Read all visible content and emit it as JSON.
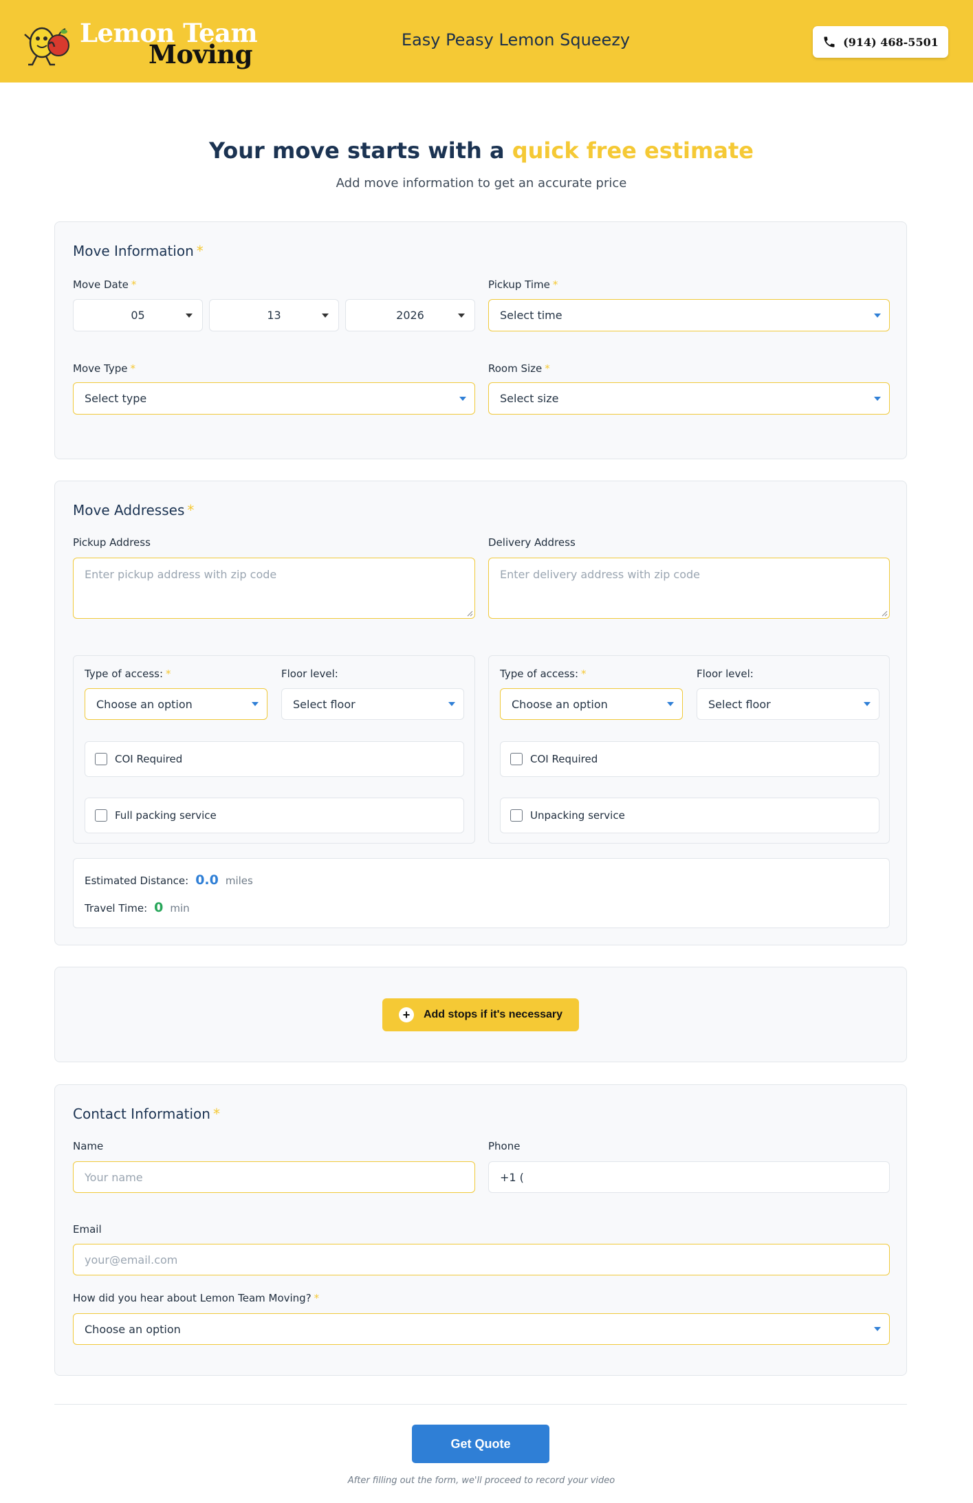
{
  "header": {
    "logo_line1": "Lemon Team",
    "logo_line2": "Moving",
    "tagline": "Easy Peasy Lemon Squeezy",
    "phone": "(914) 468-5501",
    "phone_icon": "phone-icon"
  },
  "hero": {
    "title_main": "Your move starts with a ",
    "title_accent": "quick free estimate",
    "subtitle": "Add move information to get an accurate price"
  },
  "move_info": {
    "title": "Move Information",
    "required_mark": "*",
    "move_date_label": "Move Date",
    "month": "05",
    "day": "13",
    "year": "2026",
    "pickup_time_label": "Pickup Time",
    "pickup_time_value": "Select time",
    "move_type_label": "Move Type",
    "move_type_value": "Select type",
    "room_size_label": "Room Size",
    "room_size_value": "Select size"
  },
  "addresses": {
    "title": "Move Addresses",
    "pickup_label": "Pickup Address",
    "pickup_placeholder": "Enter pickup address with zip code",
    "delivery_label": "Delivery Address",
    "delivery_placeholder": "Enter delivery address with zip code",
    "pickup_panel": {
      "access_label": "Type of access:",
      "access_value": "Choose an option",
      "floor_label": "Floor level:",
      "floor_value": "Select floor",
      "coi_label": "COI Required",
      "service_label": "Full packing service"
    },
    "delivery_panel": {
      "access_label": "Type of access:",
      "access_value": "Choose an option",
      "floor_label": "Floor level:",
      "floor_value": "Select floor",
      "coi_label": "COI Required",
      "service_label": "Unpacking service"
    },
    "distance_label": "Estimated Distance:",
    "distance_value": "0.0",
    "distance_unit": "miles",
    "travel_label": "Travel Time:",
    "travel_value": "0",
    "travel_unit": "min"
  },
  "stops": {
    "button_label": "Add stops if it's necessary",
    "icon": "plus-circle-icon"
  },
  "contact": {
    "title": "Contact Information",
    "name_label": "Name",
    "name_placeholder": "Your name",
    "phone_label": "Phone",
    "phone_value": "+1 (",
    "email_label": "Email",
    "email_placeholder": "your@email.com",
    "referral_label": "How did you hear about Lemon Team Moving?",
    "referral_value": "Choose an option"
  },
  "submit": {
    "button_label": "Get Quote",
    "footnote": "After filling out the form, we'll proceed to record your video"
  },
  "colors": {
    "brand_yellow": "#f5c935",
    "navy": "#1b3352",
    "accent_blue": "#2f7fd6",
    "accent_green": "#28a65a"
  }
}
